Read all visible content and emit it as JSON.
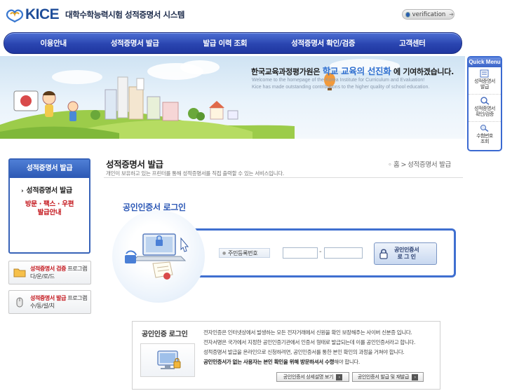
{
  "header": {
    "logo_text": "KICE",
    "system_title": "대학수학능력시험 성적증명서 시스템",
    "verification_label": "verification"
  },
  "nav": {
    "items": [
      "이용안내",
      "성적증명서 발급",
      "발급 이력 조회",
      "성적증명서 확인/검증",
      "고객센터"
    ]
  },
  "banner": {
    "slogan_pre": "한국교육과정평가원은",
    "slogan_highlight": "학교 교육의 선진화",
    "slogan_post": "에 기여하겠습니다.",
    "english_line1": "Welcome to the homepage of the Korea Institute for Curriculum and Evaluation!",
    "english_line2": "Kice has made outstanding contributions to the higher quality of school education."
  },
  "quick_menu": {
    "title": "Quick Menu",
    "items": [
      {
        "line1": "성적증명서",
        "line2": "발급"
      },
      {
        "line1": "성적증명서",
        "line2": "확인/검증"
      },
      {
        "line1": "수험번호",
        "line2": "조회"
      }
    ]
  },
  "sidebar": {
    "header": "성적증명서 발급",
    "item_current": "성적증명서 발급",
    "item_other_line1": "방문 · 팩스 · 우편",
    "item_other_line2": "발급안내",
    "download_verify": {
      "red": "성적증명서 검증",
      "rest": " 프로그램",
      "line2": "다/운/로/드"
    },
    "download_issue": {
      "red": "성적증명서 발급",
      "rest": " 프로그램",
      "line2": "수/동/설/치"
    }
  },
  "content": {
    "page_title": "성적증명서 발급",
    "page_desc": "개인이 보유하고 있는 프린터를 통해 성적증명서를 직접 출력할 수 있는 서비스입니다.",
    "breadcrumb_home": "홈",
    "breadcrumb_sep": ">",
    "breadcrumb_current": "성적증명서 발급"
  },
  "login": {
    "heading": "공인인증서 로그인",
    "rrn_label": "주민등록번호",
    "rrn_dash": "-",
    "button_line1": "공인인증서",
    "button_line2": "로 그 인"
  },
  "info": {
    "title": "공인인증 로그인",
    "lines": [
      "전자인증은 인터넷상에서 발생하는 모든 전자거래에서 신원을 확인 보장해주는 사이버 신분증 입니다.",
      "전자서명은 국가에서 지정한 공인인증기관에서 인증서 형태로 발급되는데 이를 공인인증서라고 합니다.",
      "성적증명서 발급을 온라인으로 신청하려면, 공인인증서를 통한 본인 확인의 과정을 거쳐야 합니다."
    ],
    "notice_bold": "공인인증서가 없는 사용자는 본인 확인을 위해 방문하셔서 수령",
    "notice_rest": "해야 합니다.",
    "button_guide": "공인인증서 상세설명 보기",
    "button_issue": "공인인증서 발급 및 재발급"
  },
  "colors": {
    "brand_blue": "#2a45b0",
    "accent_blue": "#2f6fcf",
    "alert_red": "#c4161c"
  }
}
